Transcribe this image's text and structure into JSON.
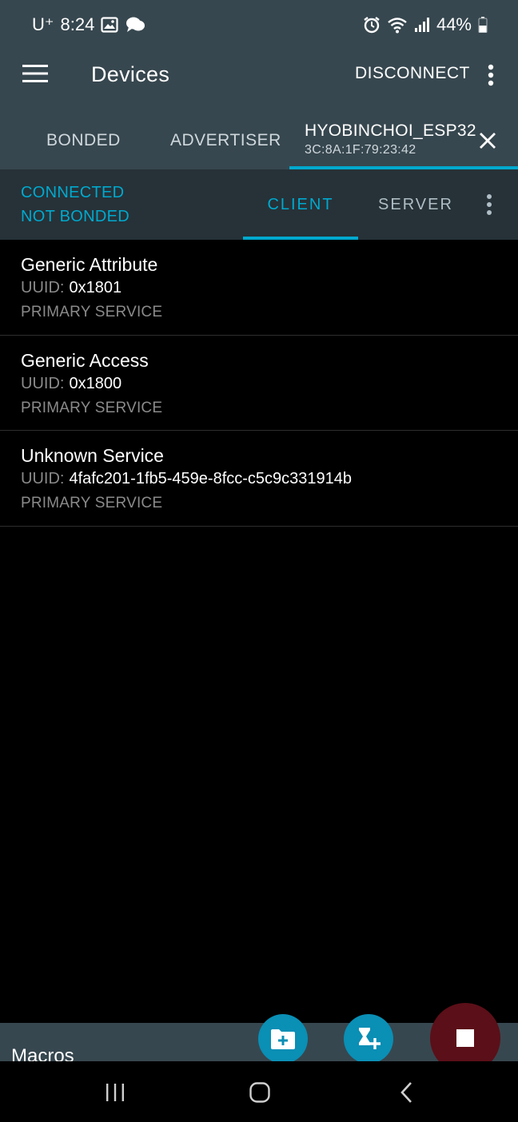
{
  "status_bar": {
    "carrier": "U⁺",
    "time": "8:24",
    "battery": "44%",
    "left_icons": [
      "image-icon",
      "chat-bubble-icon"
    ],
    "right_icons": [
      "alarm-icon",
      "wifi-icon",
      "signal-icon",
      "battery-icon"
    ]
  },
  "app_bar": {
    "title": "Devices",
    "disconnect_label": "DISCONNECT"
  },
  "device_tabs": {
    "bonded": "BONDED",
    "advertiser": "ADVERTISER",
    "active_device_name": "HYOBINCHOI_ESP32",
    "active_device_address": "3C:8A:1F:79:23:42"
  },
  "connection": {
    "state": "CONNECTED",
    "bond_state": "NOT BONDED",
    "tab_client": "CLIENT",
    "tab_server": "SERVER",
    "active_tab": "CLIENT"
  },
  "services": [
    {
      "name": "Generic Attribute",
      "uuid_label": "UUID:",
      "uuid": "0x1801",
      "type": "PRIMARY SERVICE"
    },
    {
      "name": "Generic Access",
      "uuid_label": "UUID:",
      "uuid": "0x1800",
      "type": "PRIMARY SERVICE"
    },
    {
      "name": "Unknown Service",
      "uuid_label": "UUID:",
      "uuid": "4fafc201-1fb5-459e-8fcc-c5c9c331914b",
      "type": "PRIMARY SERVICE"
    }
  ],
  "macros": {
    "title": "Macros"
  },
  "colors": {
    "accent": "#00a9ce",
    "app_bar": "#37474f",
    "panel": "#263238",
    "fab": "#0a8fb5",
    "stop_fab": "#5b0f18"
  }
}
